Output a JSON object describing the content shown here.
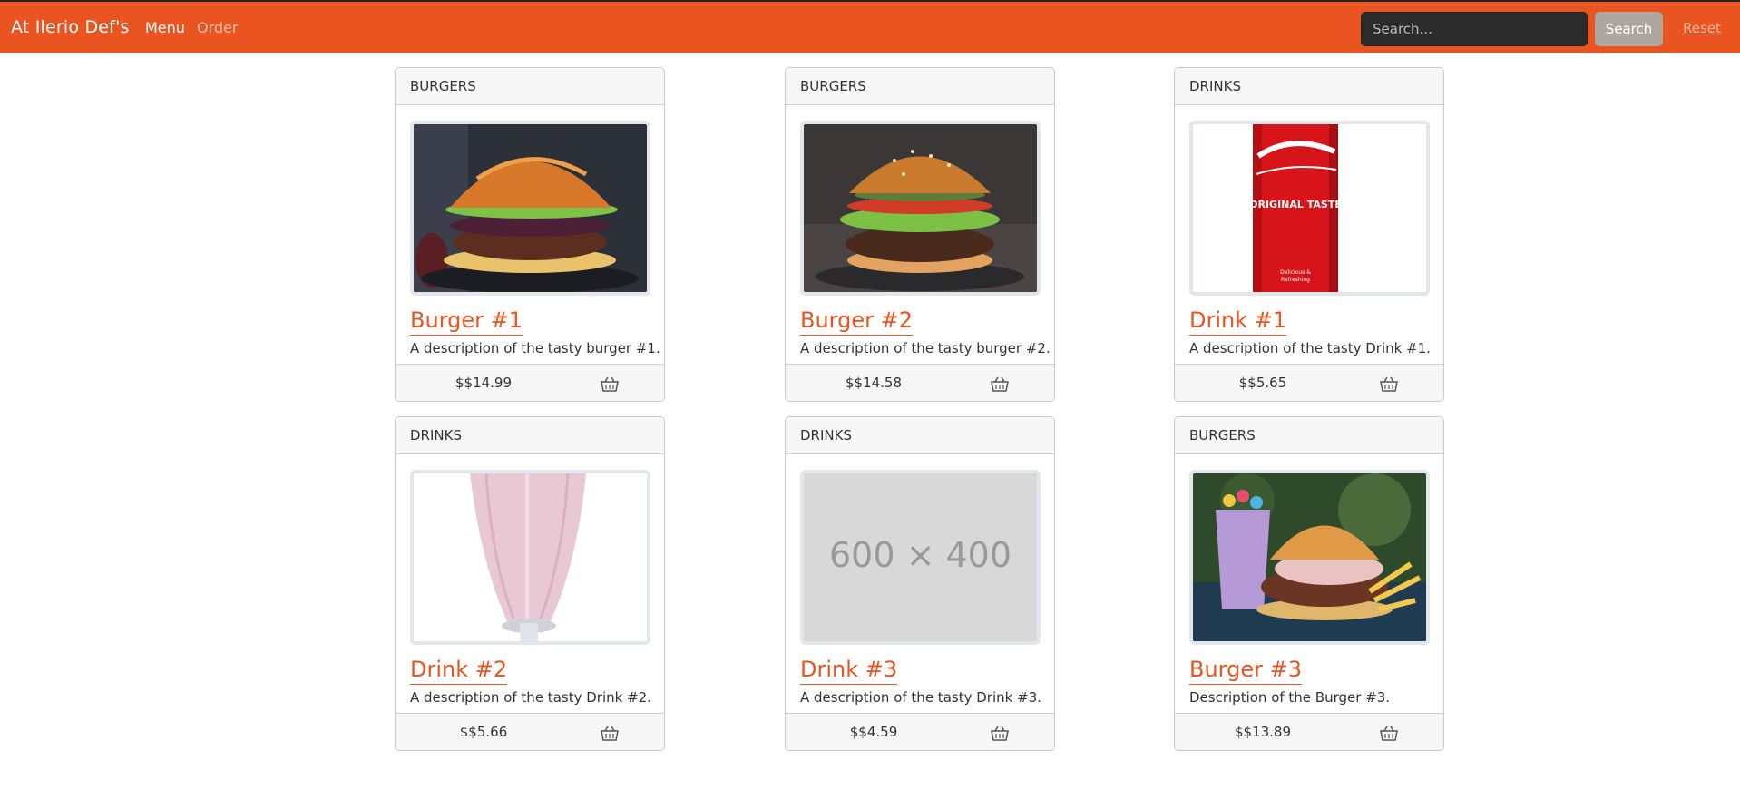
{
  "navbar": {
    "brand": "At Ilerio Def's",
    "menu_label": "Menu",
    "order_label": "Order",
    "search_placeholder": "Search...",
    "search_button": "Search",
    "reset_label": "Reset"
  },
  "colors": {
    "brand": "#e95420",
    "search_button": "#aea79f",
    "search_input": "#2b2b2b"
  },
  "products": [
    {
      "category": "BURGERS",
      "title": "Burger #1",
      "description": "A description of the tasty burger #1.",
      "price": "$$14.99",
      "image": "burger-photo",
      "basket_icon": "basket-icon"
    },
    {
      "category": "BURGERS",
      "title": "Burger #2",
      "description": "A description of the tasty burger #2.",
      "price": "$$14.58",
      "image": "burger-photo",
      "basket_icon": "basket-icon"
    },
    {
      "category": "DRINKS",
      "title": "Drink #1",
      "description": "A description of the tasty Drink #1.",
      "price": "$$5.65",
      "image": "cola-can-photo",
      "image_text": "Coca-Cola ORIGINAL TASTE",
      "basket_icon": "basket-icon"
    },
    {
      "category": "DRINKS",
      "title": "Drink #2",
      "description": "A description of the tasty Drink #2.",
      "price": "$$5.66",
      "image": "milkshake-photo",
      "basket_icon": "basket-icon"
    },
    {
      "category": "DRINKS",
      "title": "Drink #3",
      "description": "A description of the tasty Drink #3.",
      "price": "$$4.59",
      "image": "placeholder-image",
      "image_text": "600 × 400",
      "basket_icon": "basket-icon"
    },
    {
      "category": "BURGERS",
      "title": "Burger #3",
      "description": "Description of the Burger #3.",
      "price": "$$13.89",
      "image": "burger-and-shake-photo",
      "basket_icon": "basket-icon"
    }
  ]
}
